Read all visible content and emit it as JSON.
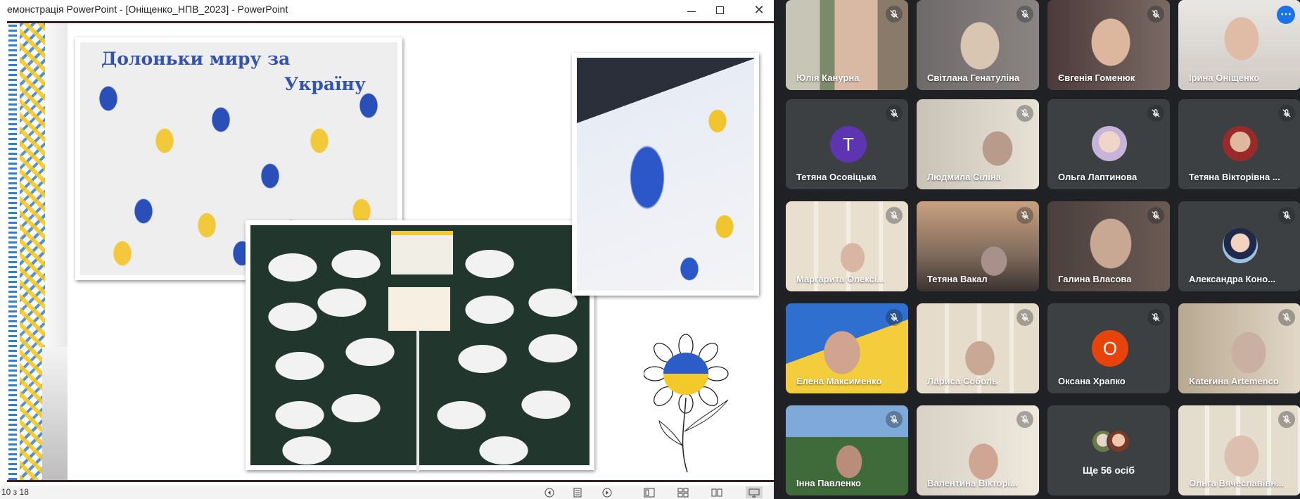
{
  "ppt": {
    "title": "емонстрація PowerPoint - [Оніщенко_НПВ_2023] - PowerPoint",
    "slide_caption_line1": "Долоньки миру за",
    "slide_caption_line2": "Україну",
    "slide_counter": "10 з 18"
  },
  "colors": {
    "meet_bg": "#202124",
    "tile_bg": "#3c4043",
    "accent_blue": "#1a73e8",
    "ukraine_blue": "#2a4fb8",
    "ukraine_yellow": "#f3c83a"
  },
  "participants": [
    {
      "name": "Юлія Канурна",
      "muted": true,
      "icon": "mic-off-icon"
    },
    {
      "name": "Світлана Генатуліна",
      "muted": true,
      "icon": "mic-off-icon"
    },
    {
      "name": "Євгенія Гоменюк",
      "muted": true,
      "icon": "mic-off-icon"
    },
    {
      "name": "Ірина Оніщенко",
      "muted": false,
      "icon": "more-options-icon",
      "active": true
    },
    {
      "name": "Тетяна Осовіцька",
      "muted": true,
      "avatar_letter": "T",
      "avatar_color": "#5e35b1"
    },
    {
      "name": "Людмила Сіліна",
      "muted": true
    },
    {
      "name": "Ольга Лаптинова",
      "muted": true
    },
    {
      "name": "Тетяна Вікторівна ...",
      "muted": true
    },
    {
      "name": "Маргарита Олексі...",
      "muted": true
    },
    {
      "name": "Тетяна Вакал",
      "muted": true
    },
    {
      "name": "Галина Власова",
      "muted": true
    },
    {
      "name": "Александра Коно...",
      "muted": true
    },
    {
      "name": "Елена Максименко",
      "muted": true
    },
    {
      "name": "Лариса Соболь",
      "muted": true
    },
    {
      "name": "Оксана Храпко",
      "muted": true,
      "avatar_letter": "O",
      "avatar_color": "#e8430a"
    },
    {
      "name": "Katerина Artemenco",
      "muted": true
    },
    {
      "name": "Інна Павленко",
      "muted": true
    },
    {
      "name": "Валентина Вікторі...",
      "muted": true
    },
    {
      "more_label": "Ще 56 осіб"
    },
    {
      "name": "Ольга Вячеславівн...",
      "muted": true
    }
  ]
}
